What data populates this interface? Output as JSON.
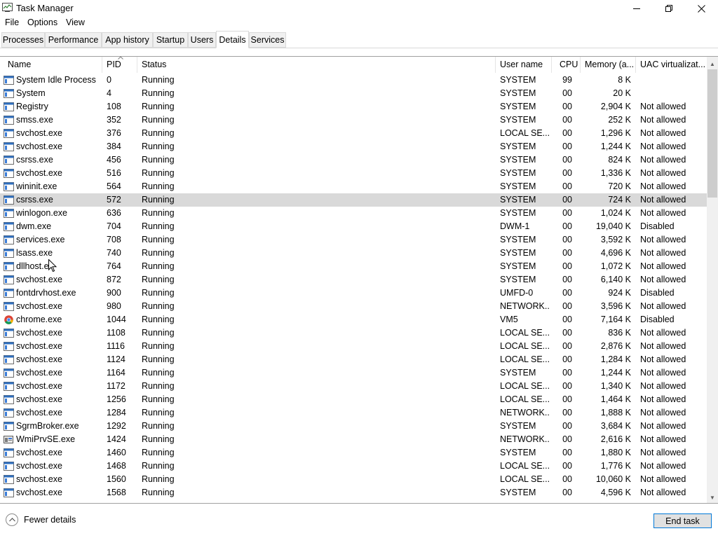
{
  "window": {
    "title": "Task Manager",
    "icon": "task-manager-icon",
    "controls": [
      "minimize-icon",
      "restore-icon",
      "close-icon"
    ]
  },
  "menu": [
    "File",
    "Options",
    "View"
  ],
  "tabs": [
    {
      "label": "Processes",
      "active": false
    },
    {
      "label": "Performance",
      "active": false
    },
    {
      "label": "App history",
      "active": false
    },
    {
      "label": "Startup",
      "active": false
    },
    {
      "label": "Users",
      "active": false
    },
    {
      "label": "Details",
      "active": true
    },
    {
      "label": "Services",
      "active": false
    }
  ],
  "columns": {
    "name": "Name",
    "pid": "PID",
    "status": "Status",
    "user": "User name",
    "cpu": "CPU",
    "memory": "Memory (a...",
    "uac": "UAC virtualizat..."
  },
  "sort_column": "pid",
  "rows": [
    {
      "name": "System Idle Process",
      "pid": "0",
      "status": "Running",
      "user": "SYSTEM",
      "cpu": "99",
      "memory": "8 K",
      "uac": "",
      "icon": "process-icon"
    },
    {
      "name": "System",
      "pid": "4",
      "status": "Running",
      "user": "SYSTEM",
      "cpu": "00",
      "memory": "20 K",
      "uac": "",
      "icon": "process-icon"
    },
    {
      "name": "Registry",
      "pid": "108",
      "status": "Running",
      "user": "SYSTEM",
      "cpu": "00",
      "memory": "2,904 K",
      "uac": "Not allowed",
      "icon": "process-icon"
    },
    {
      "name": "smss.exe",
      "pid": "352",
      "status": "Running",
      "user": "SYSTEM",
      "cpu": "00",
      "memory": "252 K",
      "uac": "Not allowed",
      "icon": "process-icon"
    },
    {
      "name": "svchost.exe",
      "pid": "376",
      "status": "Running",
      "user": "LOCAL SE...",
      "cpu": "00",
      "memory": "1,296 K",
      "uac": "Not allowed",
      "icon": "process-icon"
    },
    {
      "name": "svchost.exe",
      "pid": "384",
      "status": "Running",
      "user": "SYSTEM",
      "cpu": "00",
      "memory": "1,244 K",
      "uac": "Not allowed",
      "icon": "process-icon"
    },
    {
      "name": "csrss.exe",
      "pid": "456",
      "status": "Running",
      "user": "SYSTEM",
      "cpu": "00",
      "memory": "824 K",
      "uac": "Not allowed",
      "icon": "process-icon"
    },
    {
      "name": "svchost.exe",
      "pid": "516",
      "status": "Running",
      "user": "SYSTEM",
      "cpu": "00",
      "memory": "1,336 K",
      "uac": "Not allowed",
      "icon": "process-icon"
    },
    {
      "name": "wininit.exe",
      "pid": "564",
      "status": "Running",
      "user": "SYSTEM",
      "cpu": "00",
      "memory": "720 K",
      "uac": "Not allowed",
      "icon": "process-icon"
    },
    {
      "name": "csrss.exe",
      "pid": "572",
      "status": "Running",
      "user": "SYSTEM",
      "cpu": "00",
      "memory": "724 K",
      "uac": "Not allowed",
      "icon": "process-icon",
      "selected": true
    },
    {
      "name": "winlogon.exe",
      "pid": "636",
      "status": "Running",
      "user": "SYSTEM",
      "cpu": "00",
      "memory": "1,024 K",
      "uac": "Not allowed",
      "icon": "process-icon"
    },
    {
      "name": "dwm.exe",
      "pid": "704",
      "status": "Running",
      "user": "DWM-1",
      "cpu": "00",
      "memory": "19,040 K",
      "uac": "Disabled",
      "icon": "process-icon"
    },
    {
      "name": "services.exe",
      "pid": "708",
      "status": "Running",
      "user": "SYSTEM",
      "cpu": "00",
      "memory": "3,592 K",
      "uac": "Not allowed",
      "icon": "process-icon"
    },
    {
      "name": "lsass.exe",
      "pid": "740",
      "status": "Running",
      "user": "SYSTEM",
      "cpu": "00",
      "memory": "4,696 K",
      "uac": "Not allowed",
      "icon": "process-icon"
    },
    {
      "name": "dllhost.e",
      "pid": "764",
      "status": "Running",
      "user": "SYSTEM",
      "cpu": "00",
      "memory": "1,072 K",
      "uac": "Not allowed",
      "icon": "process-icon"
    },
    {
      "name": "svchost.exe",
      "pid": "872",
      "status": "Running",
      "user": "SYSTEM",
      "cpu": "00",
      "memory": "6,140 K",
      "uac": "Not allowed",
      "icon": "process-icon"
    },
    {
      "name": "fontdrvhost.exe",
      "pid": "900",
      "status": "Running",
      "user": "UMFD-0",
      "cpu": "00",
      "memory": "924 K",
      "uac": "Disabled",
      "icon": "process-icon"
    },
    {
      "name": "svchost.exe",
      "pid": "980",
      "status": "Running",
      "user": "NETWORK...",
      "cpu": "00",
      "memory": "3,596 K",
      "uac": "Not allowed",
      "icon": "process-icon"
    },
    {
      "name": "chrome.exe",
      "pid": "1044",
      "status": "Running",
      "user": "VM5",
      "cpu": "00",
      "memory": "7,164 K",
      "uac": "Disabled",
      "icon": "chrome-icon"
    },
    {
      "name": "svchost.exe",
      "pid": "1108",
      "status": "Running",
      "user": "LOCAL SE...",
      "cpu": "00",
      "memory": "836 K",
      "uac": "Not allowed",
      "icon": "process-icon"
    },
    {
      "name": "svchost.exe",
      "pid": "1116",
      "status": "Running",
      "user": "LOCAL SE...",
      "cpu": "00",
      "memory": "2,876 K",
      "uac": "Not allowed",
      "icon": "process-icon"
    },
    {
      "name": "svchost.exe",
      "pid": "1124",
      "status": "Running",
      "user": "LOCAL SE...",
      "cpu": "00",
      "memory": "1,284 K",
      "uac": "Not allowed",
      "icon": "process-icon"
    },
    {
      "name": "svchost.exe",
      "pid": "1164",
      "status": "Running",
      "user": "SYSTEM",
      "cpu": "00",
      "memory": "1,244 K",
      "uac": "Not allowed",
      "icon": "process-icon"
    },
    {
      "name": "svchost.exe",
      "pid": "1172",
      "status": "Running",
      "user": "LOCAL SE...",
      "cpu": "00",
      "memory": "1,340 K",
      "uac": "Not allowed",
      "icon": "process-icon"
    },
    {
      "name": "svchost.exe",
      "pid": "1256",
      "status": "Running",
      "user": "LOCAL SE...",
      "cpu": "00",
      "memory": "1,464 K",
      "uac": "Not allowed",
      "icon": "process-icon"
    },
    {
      "name": "svchost.exe",
      "pid": "1284",
      "status": "Running",
      "user": "NETWORK...",
      "cpu": "00",
      "memory": "1,888 K",
      "uac": "Not allowed",
      "icon": "process-icon"
    },
    {
      "name": "SgrmBroker.exe",
      "pid": "1292",
      "status": "Running",
      "user": "SYSTEM",
      "cpu": "00",
      "memory": "3,684 K",
      "uac": "Not allowed",
      "icon": "process-icon"
    },
    {
      "name": "WmiPrvSE.exe",
      "pid": "1424",
      "status": "Running",
      "user": "NETWORK...",
      "cpu": "00",
      "memory": "2,616 K",
      "uac": "Not allowed",
      "icon": "wmi-icon"
    },
    {
      "name": "svchost.exe",
      "pid": "1460",
      "status": "Running",
      "user": "SYSTEM",
      "cpu": "00",
      "memory": "1,880 K",
      "uac": "Not allowed",
      "icon": "process-icon"
    },
    {
      "name": "svchost.exe",
      "pid": "1468",
      "status": "Running",
      "user": "LOCAL SE...",
      "cpu": "00",
      "memory": "1,776 K",
      "uac": "Not allowed",
      "icon": "process-icon"
    },
    {
      "name": "svchost.exe",
      "pid": "1560",
      "status": "Running",
      "user": "LOCAL SE...",
      "cpu": "00",
      "memory": "10,060 K",
      "uac": "Not allowed",
      "icon": "process-icon"
    },
    {
      "name": "svchost.exe",
      "pid": "1568",
      "status": "Running",
      "user": "SYSTEM",
      "cpu": "00",
      "memory": "4,596 K",
      "uac": "Not allowed",
      "icon": "process-icon"
    }
  ],
  "footer": {
    "fewer_details": "Fewer details",
    "end_task": "End task"
  },
  "colors": {
    "selected_row": "#d9d9d9",
    "focus_border": "#0078d7"
  }
}
